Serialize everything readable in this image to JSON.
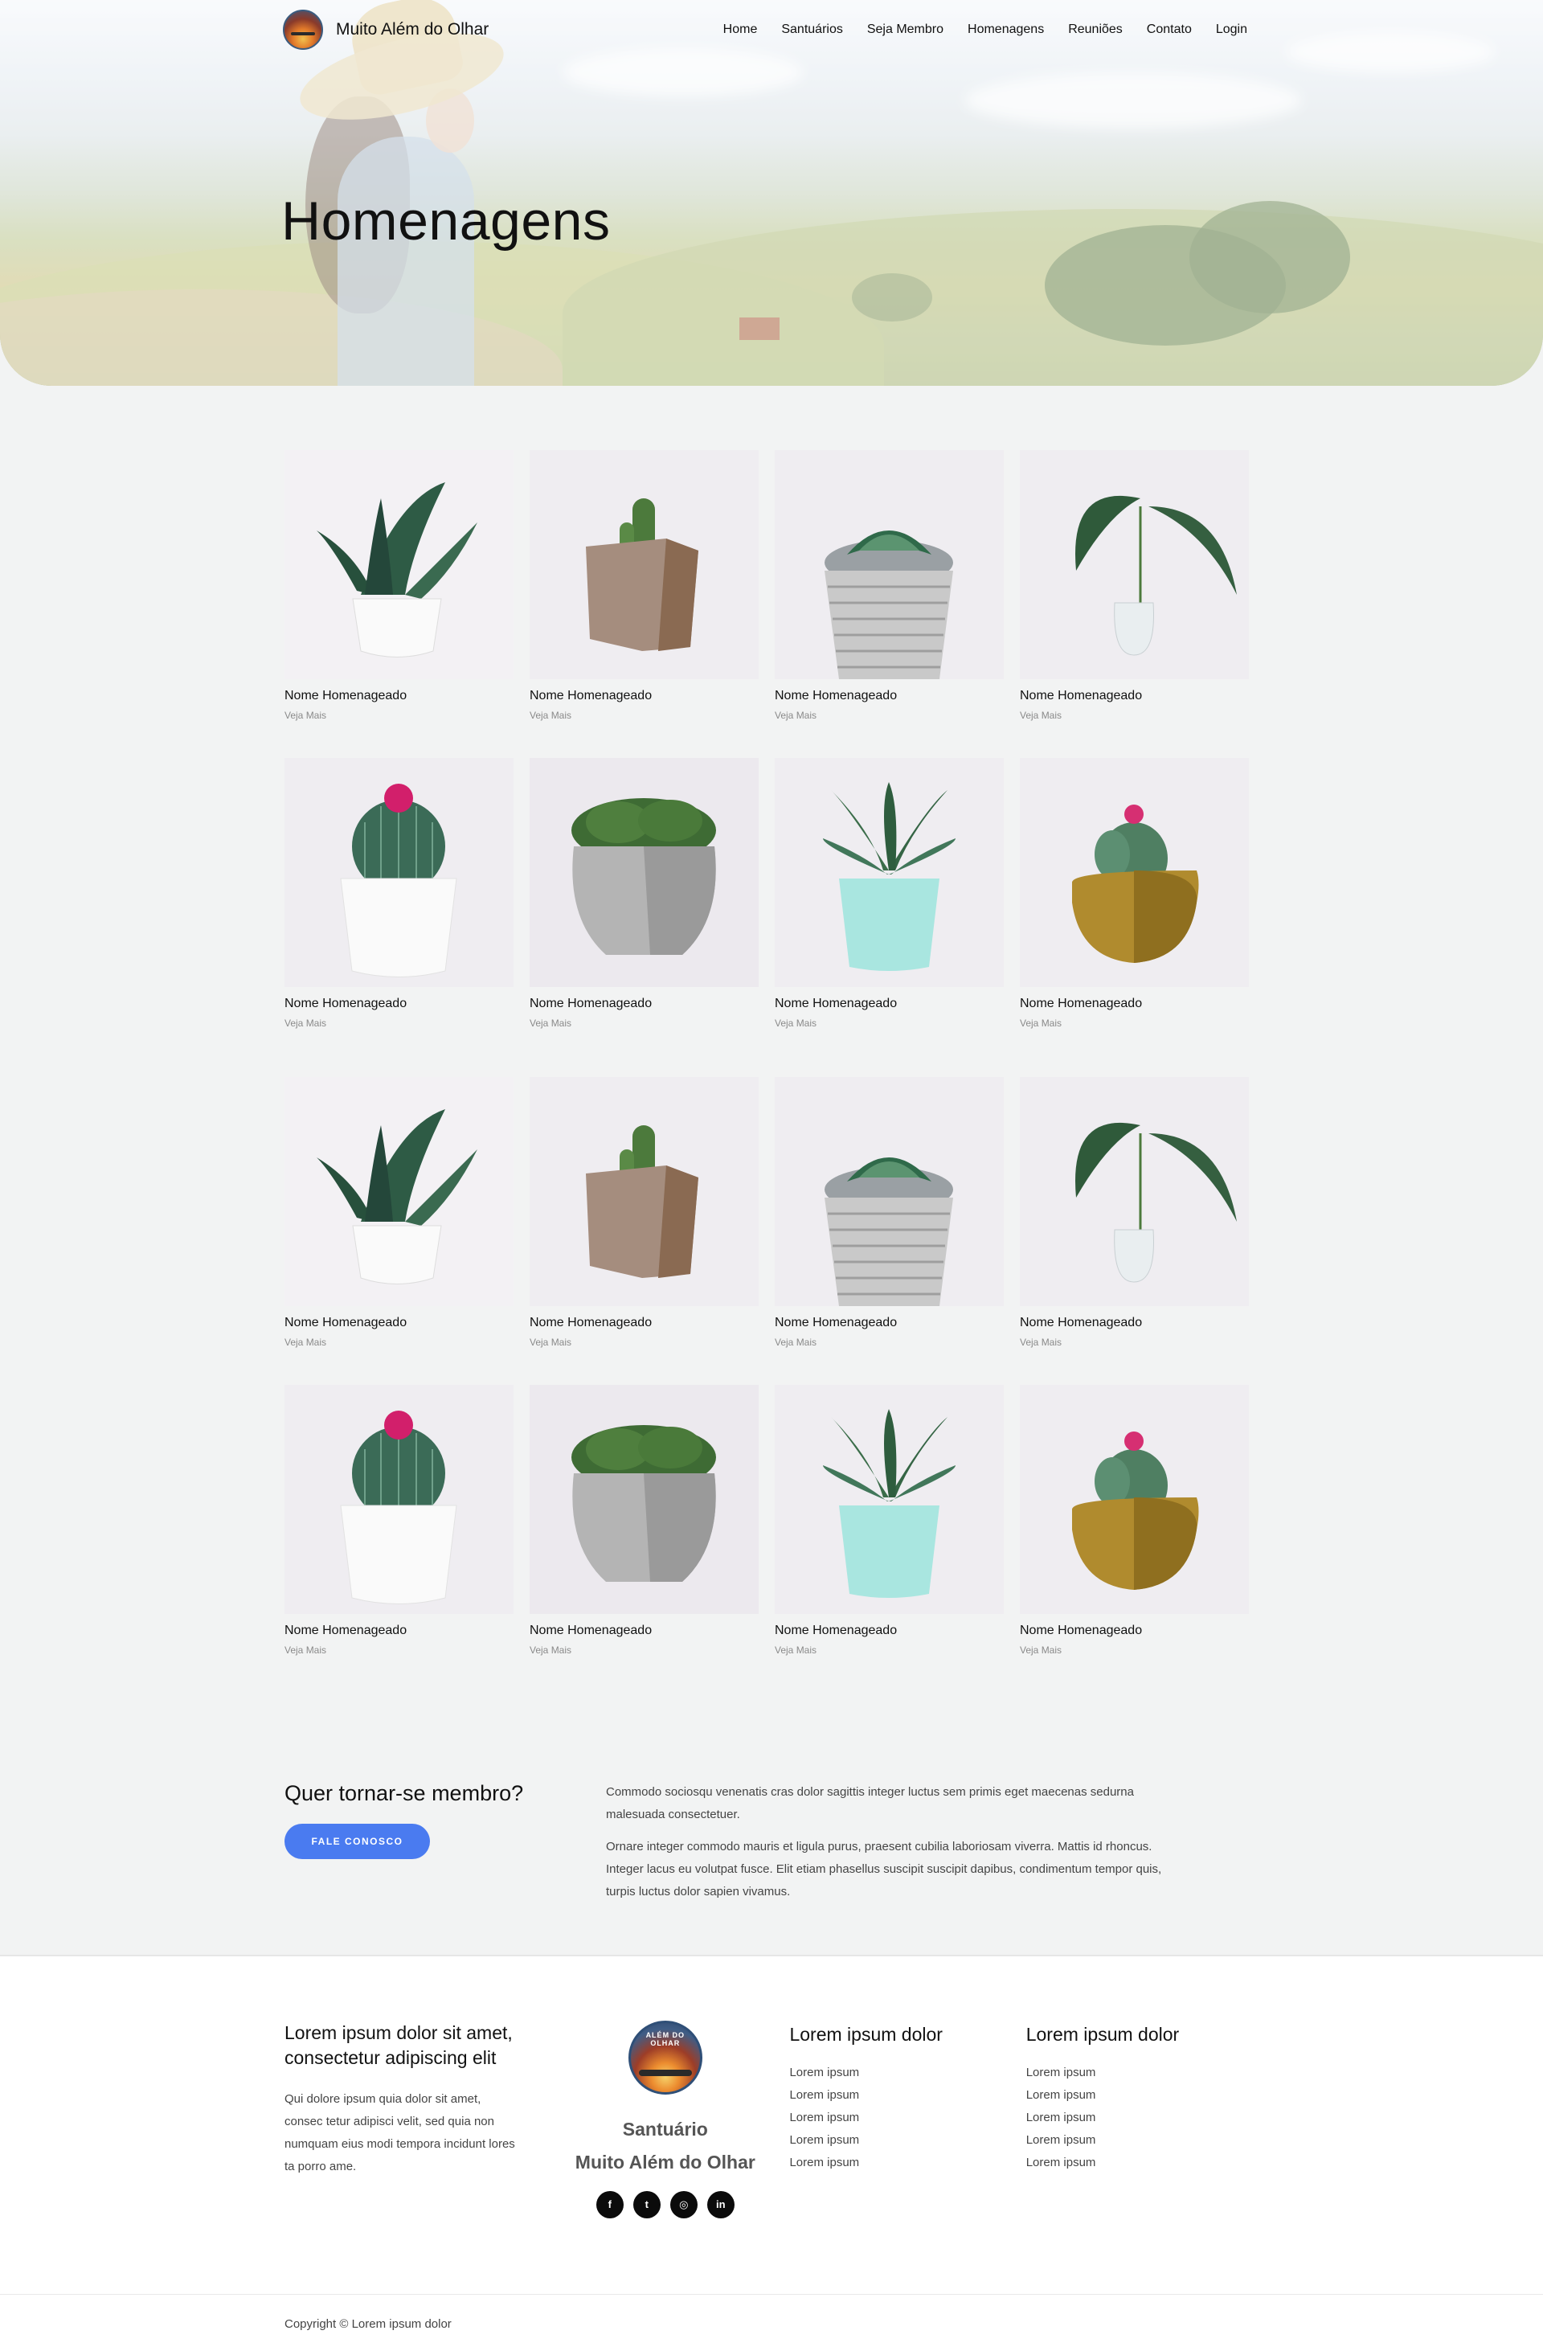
{
  "brand": {
    "name": "Muito Além do Olhar"
  },
  "nav": {
    "items": [
      {
        "label": "Home"
      },
      {
        "label": "Santuários"
      },
      {
        "label": "Seja Membro"
      },
      {
        "label": "Homenagens"
      },
      {
        "label": "Reuniões"
      },
      {
        "label": "Contato"
      },
      {
        "label": "Login"
      }
    ]
  },
  "hero": {
    "title": "Homenagens"
  },
  "cards": [
    {
      "name": "Nome Homenageado",
      "more": "Veja Mais",
      "plant": "aloe-white-pot"
    },
    {
      "name": "Nome Homenageado",
      "more": "Veja Mais",
      "plant": "cactus-square-pot"
    },
    {
      "name": "Nome Homenageado",
      "more": "Veja Mais",
      "plant": "succulent-rope-pot"
    },
    {
      "name": "Nome Homenageado",
      "more": "Veja Mais",
      "plant": "leaf-glass-vase"
    },
    {
      "name": "Nome Homenageado",
      "more": "Veja Mais",
      "plant": "flowering-cactus-white-pot"
    },
    {
      "name": "Nome Homenageado",
      "more": "Veja Mais",
      "plant": "moss-concrete-pot"
    },
    {
      "name": "Nome Homenageado",
      "more": "Veja Mais",
      "plant": "aloe-mint-pot"
    },
    {
      "name": "Nome Homenageado",
      "more": "Veja Mais",
      "plant": "cactus-brass-pot"
    },
    {
      "name": "Nome Homenageado",
      "more": "Veja Mais",
      "plant": "aloe-white-pot"
    },
    {
      "name": "Nome Homenageado",
      "more": "Veja Mais",
      "plant": "cactus-square-pot"
    },
    {
      "name": "Nome Homenageado",
      "more": "Veja Mais",
      "plant": "succulent-rope-pot"
    },
    {
      "name": "Nome Homenageado",
      "more": "Veja Mais",
      "plant": "leaf-glass-vase"
    },
    {
      "name": "Nome Homenageado",
      "more": "Veja Mais",
      "plant": "flowering-cactus-white-pot"
    },
    {
      "name": "Nome Homenageado",
      "more": "Veja Mais",
      "plant": "moss-concrete-pot"
    },
    {
      "name": "Nome Homenageado",
      "more": "Veja Mais",
      "plant": "aloe-mint-pot"
    },
    {
      "name": "Nome Homenageado",
      "more": "Veja Mais",
      "plant": "cactus-brass-pot"
    }
  ],
  "cta": {
    "title": "Quer tornar-se membro?",
    "button": "FALE CONOSCO",
    "p1": "Commodo sociosqu venenatis cras dolor sagittis integer luctus sem primis eget maecenas sedurna malesuada consectetuer.",
    "p2": "Ornare integer commodo mauris et ligula purus, praesent cubilia laboriosam viverra. Mattis id rhoncus. Integer lacus eu volutpat fusce. Elit etiam phasellus suscipit suscipit dapibus, condimentum tempor quis, turpis luctus dolor sapien vivamus."
  },
  "footer": {
    "col1": {
      "title": "Lorem ipsum dolor sit amet, consectetur adipiscing elit",
      "text": "Qui dolore ipsum quia dolor sit amet, consec tetur adipisci velit, sed quia non numquam eius modi tempora incidunt lores ta porro ame."
    },
    "col2": {
      "logo_text": "ALÉM DO OLHAR",
      "line1": "Santuário",
      "line2": "Muito Além do Olhar",
      "socials": [
        {
          "icon": "facebook-icon",
          "glyph": "f"
        },
        {
          "icon": "twitter-icon",
          "glyph": "t"
        },
        {
          "icon": "instagram-icon",
          "glyph": "◎"
        },
        {
          "icon": "linkedin-icon",
          "glyph": "in"
        }
      ]
    },
    "col3": {
      "title": "Lorem ipsum dolor",
      "items": [
        "Lorem ipsum",
        "Lorem ipsum",
        "Lorem ipsum",
        "Lorem ipsum",
        "Lorem ipsum"
      ]
    },
    "col4": {
      "title": "Lorem ipsum dolor",
      "items": [
        "Lorem ipsum",
        "Lorem ipsum",
        "Lorem ipsum",
        "Lorem ipsum",
        "Lorem ipsum"
      ]
    },
    "copyright": "Copyright © Lorem ipsum dolor"
  },
  "colors": {
    "accent": "#4a7bf0",
    "background": "#f2f3f3",
    "card_bg": "#efedf1"
  }
}
